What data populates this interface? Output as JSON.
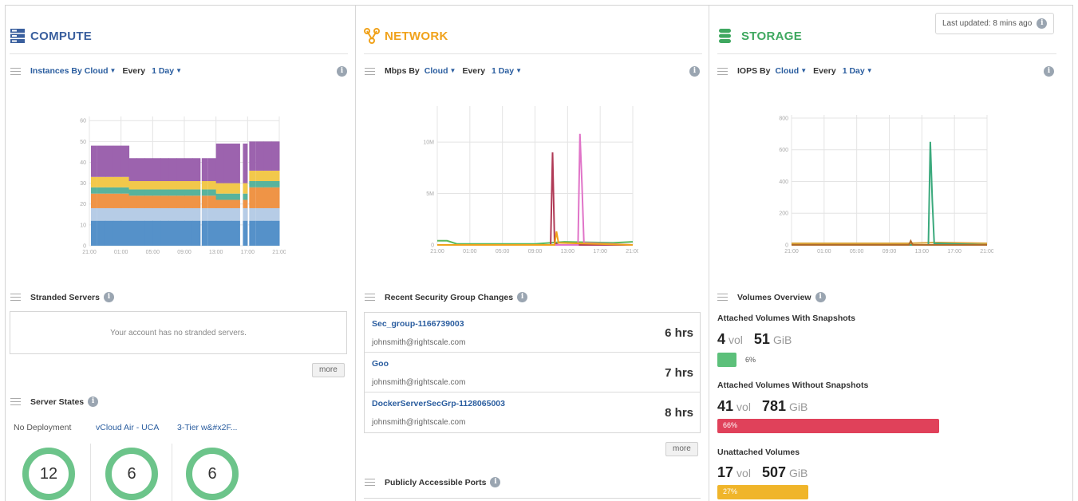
{
  "last_updated": {
    "text": "Last updated: 8 mins ago",
    "icon": "info-icon"
  },
  "compute": {
    "title": "COMPUTE",
    "icon": "server-rack-icon",
    "color": "#3a5f9e",
    "widget": {
      "metric": "Instances By",
      "group": "Cloud",
      "every_label": "Every",
      "period": "1 Day"
    },
    "stranded": {
      "title": "Stranded Servers",
      "empty_text": "Your account has no stranded servers.",
      "more": "more"
    },
    "server_states": {
      "title": "Server States",
      "groups": [
        {
          "label": "No Deployment",
          "count": "12"
        },
        {
          "label": "vCloud Air - UCA",
          "count": "6"
        },
        {
          "label": "3-Tier w&#x2F...",
          "count": "6"
        }
      ]
    }
  },
  "network": {
    "title": "NETWORK",
    "icon": "network-nodes-icon",
    "color": "#f0a21b",
    "widget": {
      "metric": "Mbps By",
      "group": "Cloud",
      "every_label": "Every",
      "period": "1 Day"
    },
    "security": {
      "title": "Recent Security Group Changes",
      "rows": [
        {
          "name": "Sec_group-1166739003",
          "email": "johnsmith@rightscale.com",
          "time": "6 hrs"
        },
        {
          "name": "Goo",
          "email": "johnsmith@rightscale.com",
          "time": "7 hrs"
        },
        {
          "name": "DockerServerSecGrp-1128065003",
          "email": "johnsmith@rightscale.com",
          "time": "8 hrs"
        }
      ],
      "more": "more"
    },
    "ports": {
      "title": "Publicly Accessible Ports"
    }
  },
  "storage": {
    "title": "STORAGE",
    "icon": "database-stack-icon",
    "color": "#3fa860",
    "widget": {
      "metric": "IOPS By",
      "group": "Cloud",
      "every_label": "Every",
      "period": "1 Day"
    },
    "volumes": {
      "title": "Volumes Overview",
      "groups": [
        {
          "label": "Attached Volumes With Snapshots",
          "vol": "4",
          "vol_unit": "vol",
          "size": "51",
          "size_unit": "GiB",
          "pct_text": "6%",
          "pct": 6,
          "color": "#5cc07a"
        },
        {
          "label": "Attached Volumes Without Snapshots",
          "vol": "41",
          "vol_unit": "vol",
          "size": "781",
          "size_unit": "GiB",
          "pct_text": "66%",
          "pct": 66,
          "color": "#e0415a"
        },
        {
          "label": "Unattached Volumes",
          "vol": "17",
          "vol_unit": "vol",
          "size": "507",
          "size_unit": "GiB",
          "pct_text": "27%",
          "pct": 27,
          "color": "#f0b52a"
        }
      ]
    }
  },
  "chart_data": [
    {
      "type": "area",
      "stacked": true,
      "x_ticks": [
        "21:00",
        "01:00",
        "05:00",
        "09:00",
        "13:00",
        "17:00",
        "21:00"
      ],
      "y_ticks": [
        0,
        10,
        20,
        30,
        40,
        50,
        60
      ],
      "ylim": [
        0,
        62
      ],
      "grid": true,
      "series": [
        {
          "color": "#5591c9",
          "values": [
            12,
            12,
            12,
            12,
            12,
            12,
            12,
            12,
            12,
            12,
            12,
            12,
            12,
            12,
            12,
            12,
            12,
            12,
            12,
            12,
            12,
            12,
            12,
            12
          ]
        },
        {
          "color": "#b6cce6",
          "values": [
            6,
            6,
            6,
            6,
            6,
            6,
            6,
            6,
            6,
            6,
            6,
            6,
            6,
            6,
            6,
            6,
            6,
            6,
            6,
            6,
            6,
            6,
            6,
            6
          ]
        },
        {
          "color": "#ef9446",
          "values": [
            7,
            7,
            7,
            7,
            7,
            6,
            6,
            6,
            6,
            6,
            6,
            6,
            6,
            6,
            6,
            6,
            4,
            4,
            4,
            4,
            10,
            10,
            10,
            10
          ]
        },
        {
          "color": "#58b39c",
          "values": [
            3,
            3,
            3,
            3,
            3,
            3,
            3,
            3,
            3,
            3,
            3,
            3,
            3,
            3,
            3,
            3,
            3,
            3,
            3,
            3,
            3,
            3,
            3,
            3
          ]
        },
        {
          "color": "#f2c84b",
          "values": [
            5,
            5,
            5,
            5,
            5,
            4,
            4,
            4,
            4,
            4,
            4,
            4,
            4,
            4,
            4,
            4,
            5,
            5,
            5,
            5,
            5,
            5,
            5,
            5
          ]
        },
        {
          "color": "#9c63ae",
          "values": [
            15,
            15,
            15,
            15,
            15,
            11,
            11,
            11,
            11,
            11,
            11,
            11,
            11,
            11,
            11,
            11,
            19,
            19,
            19,
            19,
            14,
            14,
            14,
            14
          ]
        }
      ]
    },
    {
      "type": "line",
      "x_ticks": [
        "21:00",
        "01:00",
        "05:00",
        "09:00",
        "13:00",
        "17:00",
        "21:00"
      ],
      "y_ticks": [
        {
          "v": 0,
          "t": "0"
        },
        {
          "v": 5,
          "t": "5M"
        },
        {
          "v": 10,
          "t": "10M"
        }
      ],
      "ylim": [
        0,
        13.5
      ],
      "grid": true,
      "series": [
        {
          "color": "#5cb85c",
          "points": [
            [
              0,
              0.4
            ],
            [
              0.05,
              0.4
            ],
            [
              0.1,
              0.1
            ],
            [
              0.5,
              0.1
            ],
            [
              0.65,
              0.3
            ],
            [
              0.9,
              0.2
            ],
            [
              1.0,
              0.3
            ]
          ]
        },
        {
          "color": "#b03a56",
          "points": [
            [
              0.0,
              0
            ],
            [
              0.58,
              0
            ],
            [
              0.59,
              9.0
            ],
            [
              0.6,
              0.2
            ],
            [
              0.62,
              0
            ],
            [
              1.0,
              0
            ]
          ]
        },
        {
          "color": "#e074c8",
          "points": [
            [
              0.0,
              0
            ],
            [
              0.72,
              0
            ],
            [
              0.73,
              10.8
            ],
            [
              0.74,
              6.0
            ],
            [
              0.75,
              0.2
            ],
            [
              1.0,
              0
            ]
          ]
        },
        {
          "color": "#f0a21b",
          "points": [
            [
              0.0,
              0
            ],
            [
              0.6,
              0
            ],
            [
              0.61,
              1.3
            ],
            [
              0.62,
              0.2
            ],
            [
              1.0,
              0
            ]
          ]
        }
      ]
    },
    {
      "type": "line",
      "x_ticks": [
        "21:00",
        "01:00",
        "05:00",
        "09:00",
        "13:00",
        "17:00",
        "21:00"
      ],
      "y_ticks": [
        {
          "v": 0,
          "t": "0"
        },
        {
          "v": 200,
          "t": "200"
        },
        {
          "v": 400,
          "t": "400"
        },
        {
          "v": 600,
          "t": "600"
        },
        {
          "v": 800,
          "t": "800"
        }
      ],
      "ylim": [
        0,
        820
      ],
      "grid": true,
      "series": [
        {
          "color": "#d9a33a",
          "points": [
            [
              0,
              10
            ],
            [
              0.3,
              10
            ],
            [
              0.6,
              10
            ],
            [
              0.75,
              15
            ],
            [
              1.0,
              10
            ]
          ]
        },
        {
          "color": "#3aa97c",
          "points": [
            [
              0,
              0
            ],
            [
              0.7,
              0
            ],
            [
              0.71,
              650
            ],
            [
              0.72,
              280
            ],
            [
              0.73,
              10
            ],
            [
              1.0,
              0
            ]
          ]
        },
        {
          "color": "#b06a2a",
          "points": [
            [
              0,
              0
            ],
            [
              0.6,
              0
            ],
            [
              0.61,
              25
            ],
            [
              0.62,
              0
            ],
            [
              1.0,
              0
            ]
          ]
        }
      ]
    }
  ]
}
